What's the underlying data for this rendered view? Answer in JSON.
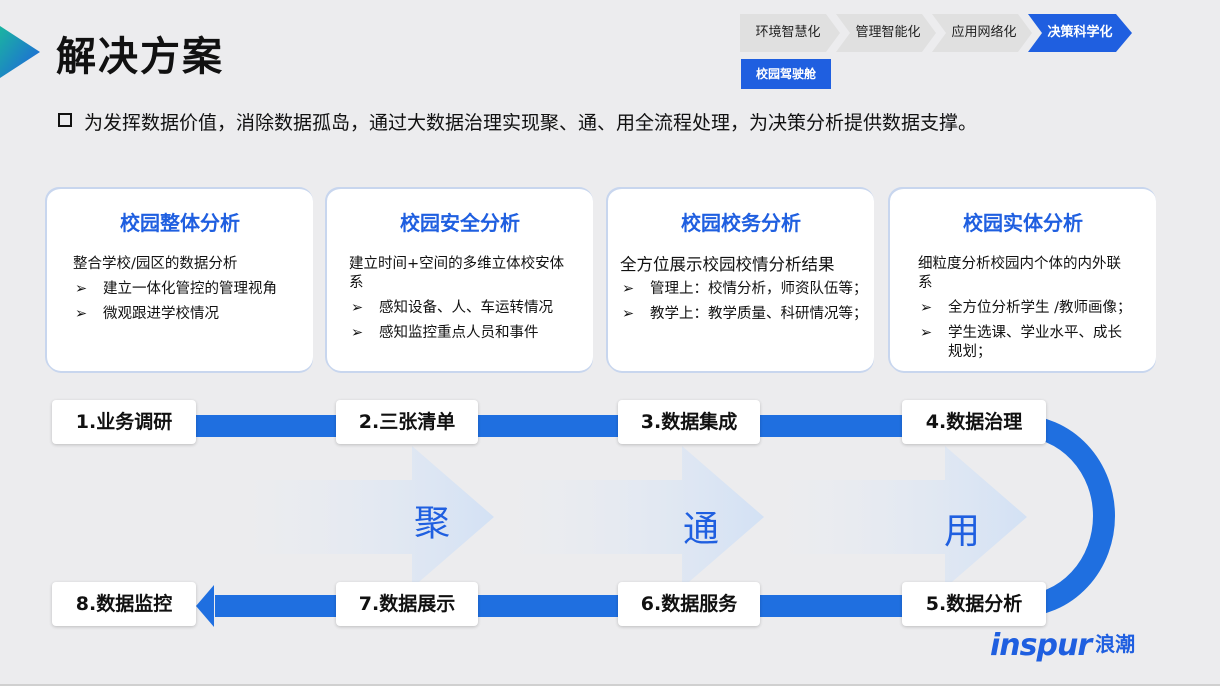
{
  "title": "解决方案",
  "nav": {
    "chevrons": [
      "环境智慧化",
      "管理智能化",
      "应用网络化",
      "决策科学化"
    ],
    "active_index": 3,
    "cockpit_label": "校园驾驶舱"
  },
  "bullet": "为发挥数据价值，消除数据孤岛，通过大数据治理实现聚、通、用全流程处理，为决策分析提供数据支撑。",
  "cards": [
    {
      "title": "校园整体分析",
      "lead": "整合学校/园区的数据分析",
      "items": [
        "建立一体化管控的管理视角",
        "微观跟进学校情况"
      ]
    },
    {
      "title": "校园安全分析",
      "lead": "建立时间+空间的多维立体校安体系",
      "items": [
        "感知设备、人、车运转情况",
        "感知监控重点人员和事件"
      ]
    },
    {
      "title": "校园校务分析",
      "lead": "全方位展示校园校情分析结果",
      "items": [
        "管理上：校情分析，师资队伍等；",
        "教学上：教学质量、科研情况等；"
      ]
    },
    {
      "title": "校园实体分析",
      "lead": "细粒度分析校园内个体的内外联系",
      "items": [
        "全方位分析学生 /教师画像；",
        "学生选课、学业水平、成长规划；"
      ]
    }
  ],
  "arrow_glyph": "➢",
  "steps": [
    "1.业务调研",
    "2.三张清单",
    "3.数据集成",
    "4.数据治理",
    "5.数据分析",
    "6.数据服务",
    "7.数据展示",
    "8.数据监控"
  ],
  "flow_chars": [
    "聚",
    "通",
    "用"
  ],
  "logo": {
    "en": "inspur",
    "cn": "浪潮"
  },
  "colors": {
    "accent": "#1f5fe0",
    "chevron_bg": "#e0e0e0",
    "pale_arrow": "#dbe6f5"
  },
  "icons": [
    "title-triangle-icon",
    "checkbox-bullet-icon",
    "arrow-right-icon"
  ]
}
